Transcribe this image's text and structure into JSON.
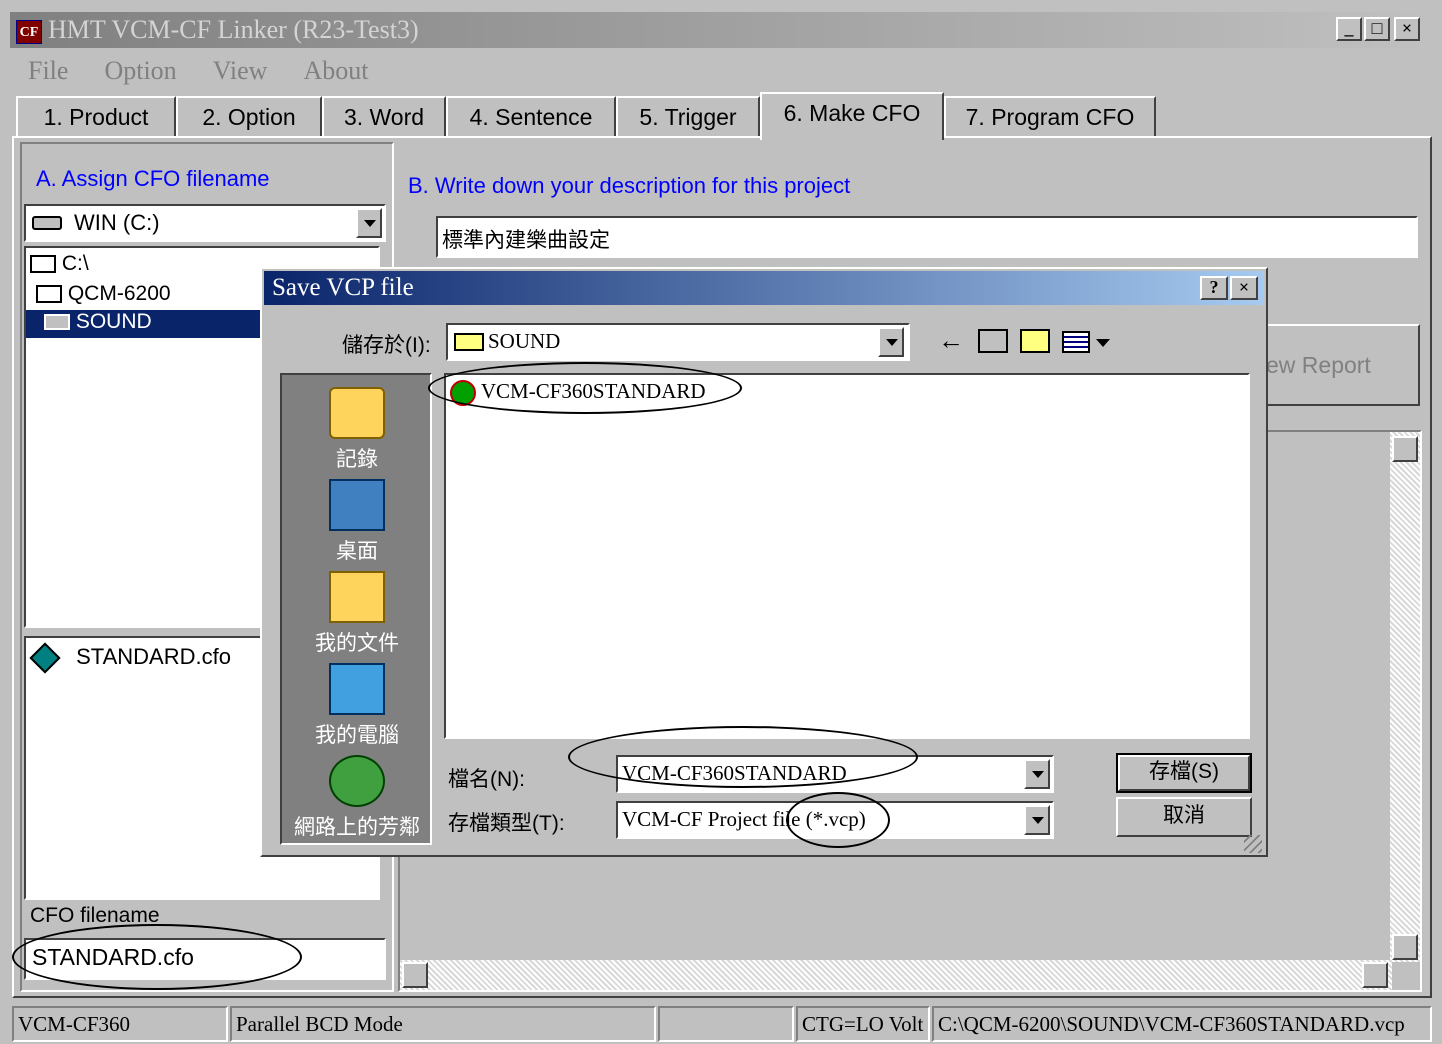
{
  "window": {
    "title": "HMT VCM-CF Linker (R23-Test3)",
    "icon_text": "CF",
    "controls": {
      "minimize": "_",
      "maximize": "□",
      "close": "×"
    }
  },
  "menu": [
    "File",
    "Option",
    "View",
    "About"
  ],
  "tabs": [
    "1. Product",
    "2. Option",
    "3. Word",
    "4. Sentence",
    "5. Trigger",
    "6. Make CFO",
    "7. Program CFO"
  ],
  "left_panel": {
    "section_label": "A. Assign CFO filename",
    "drive": "WIN (C:)",
    "folders": [
      "C:\\",
      "QCM-6200",
      "SOUND"
    ],
    "files": [
      "STANDARD.cfo"
    ],
    "filename_label": "CFO filename",
    "filename_value": "STANDARD.cfo"
  },
  "right_panel": {
    "section_label": "B. Write down your description for this project",
    "description_value": "標準內建樂曲設定",
    "view_report_label": "ew Report"
  },
  "dialog": {
    "title": "Save VCP file",
    "help": "?",
    "close": "×",
    "save_in_label": "儲存於(I):",
    "save_in_value": "SOUND",
    "places": [
      "記錄",
      "桌面",
      "我的文件",
      "我的電腦",
      "網路上的芳鄰"
    ],
    "file_list": [
      "VCM-CF360STANDARD"
    ],
    "filename_label": "檔名(N):",
    "filename_value": "VCM-CF360STANDARD",
    "filetype_label": "存檔類型(T):",
    "filetype_value": "VCM-CF Project file (*.vcp)",
    "save_button": "存檔(S)",
    "cancel_button": "取消"
  },
  "statusbar": [
    "VCM-CF360",
    "Parallel BCD Mode",
    "",
    "CTG=LO Volt",
    "C:\\QCM-6200\\SOUND\\VCM-CF360STANDARD.vcp"
  ]
}
